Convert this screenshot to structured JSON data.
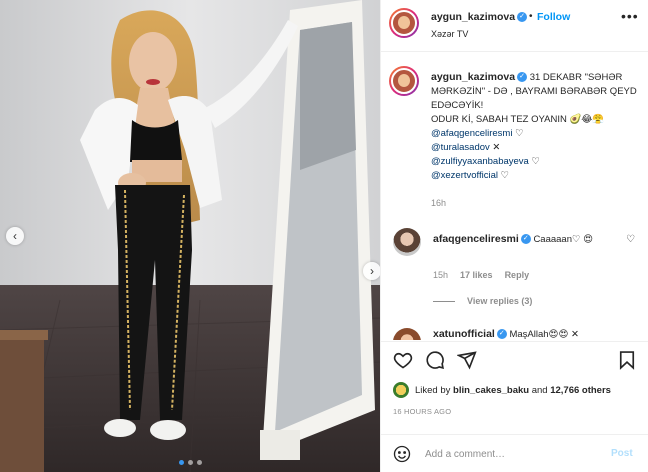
{
  "post": {
    "username": "aygun_kazimova",
    "follow_label": "Follow",
    "follow_separator": "•",
    "location": "Xəzər TV",
    "more_icon": "more-horizontal-icon",
    "caption": {
      "line1": "31 DEKABR \"SƏHƏR MƏRKƏZİN\" - DƏ , BAYRAMI BƏRABƏR QEYD EDƏCƏYİK!",
      "line2": "ODUR Kİ, SABAH TEZ OYANIN 🥑😂😤",
      "mentions": [
        {
          "handle": "@afaqgenceliresmi",
          "suffix": " ♡"
        },
        {
          "handle": "@turalasadov",
          "suffix": " ✕"
        },
        {
          "handle": "@zulfiyyaxanbabayeva",
          "suffix": " ♡"
        },
        {
          "handle": "@xezertvofficial",
          "suffix": " ♡"
        }
      ],
      "time": "16h"
    },
    "comments": [
      {
        "username": "afaqgenceliresmi",
        "text": "Caaaaan♡ 😍",
        "time": "15h",
        "likes": "17 likes",
        "reply_label": "Reply",
        "view_replies": "View replies (3)"
      },
      {
        "username": "xatunofficial",
        "text": "MaşAllah😍😍 ✕"
      }
    ],
    "likes": {
      "prefix": "Liked by ",
      "user": "blin_cakes_baku",
      "middle": " and ",
      "count": "12,766 others"
    },
    "post_time": "16 HOURS AGO",
    "add_comment": {
      "placeholder": "Add a comment…",
      "post_label": "Post"
    },
    "nav": {
      "prev": "‹",
      "next": "›"
    },
    "carousel": {
      "count": 3,
      "active_index": 0
    }
  },
  "colors": {
    "accent": "#0095f6",
    "verified": "#3897f0",
    "mention": "#00376b",
    "muted": "#8e8e8e"
  }
}
